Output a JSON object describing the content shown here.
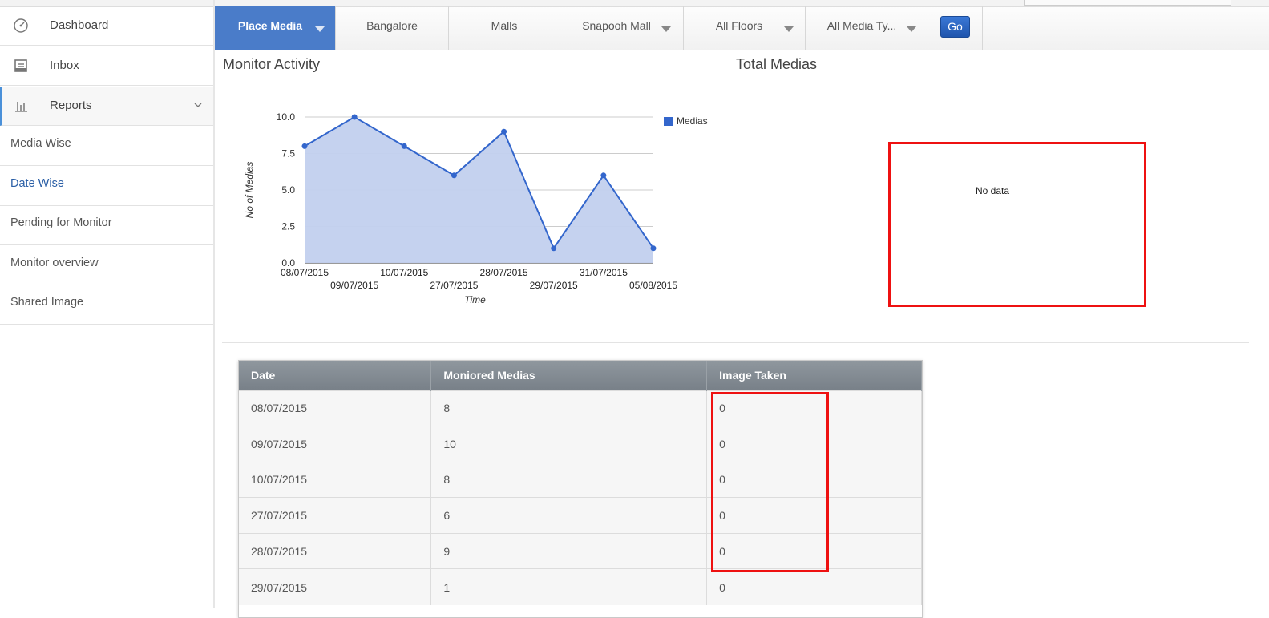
{
  "sidebar": {
    "items": [
      {
        "label": "Dashboard",
        "icon": "dashboard-gauge-icon"
      },
      {
        "label": "Inbox",
        "icon": "inbox-icon"
      },
      {
        "label": "Reports",
        "icon": "bar-chart-icon"
      }
    ],
    "reports_sub": [
      {
        "label": "Media Wise"
      },
      {
        "label": "Date Wise"
      },
      {
        "label": "Pending for Monitor"
      },
      {
        "label": "Monitor overview"
      },
      {
        "label": "Shared Image"
      }
    ]
  },
  "filters": {
    "items": [
      "Place Media",
      "Bangalore",
      "Malls",
      "Snapooh Mall",
      "All Floors",
      "All Media Ty..."
    ],
    "go_label": "Go"
  },
  "monitor": {
    "title": "Monitor Activity",
    "legend": "Medias"
  },
  "total": {
    "title": "Total Medias",
    "no_data": "No data"
  },
  "chart_data": {
    "type": "area",
    "title": "",
    "xlabel": "Time",
    "ylabel": "No of Medias",
    "ylim": [
      0,
      10
    ],
    "yticks": [
      "0.0",
      "2.5",
      "5.0",
      "7.5",
      "10.0"
    ],
    "categories": [
      "08/07/2015",
      "09/07/2015",
      "10/07/2015",
      "27/07/2015",
      "28/07/2015",
      "29/07/2015",
      "31/07/2015",
      "05/08/2015"
    ],
    "series": [
      {
        "name": "Medias",
        "values": [
          8,
          10,
          8,
          6,
          9,
          1,
          6,
          1
        ]
      }
    ],
    "legend": "top-right",
    "grid": true
  },
  "table": {
    "headers": [
      "Date",
      "Moniored Medias",
      "Image Taken"
    ],
    "rows": [
      [
        "08/07/2015",
        "8",
        "0"
      ],
      [
        "09/07/2015",
        "10",
        "0"
      ],
      [
        "10/07/2015",
        "8",
        "0"
      ],
      [
        "27/07/2015",
        "6",
        "0"
      ],
      [
        "28/07/2015",
        "9",
        "0"
      ],
      [
        "29/07/2015",
        "1",
        "0"
      ]
    ]
  },
  "colors": {
    "accent": "#4a7cc9",
    "series": "#3366cc",
    "area": "#c2d0ee",
    "highlight": "#ee1111"
  }
}
